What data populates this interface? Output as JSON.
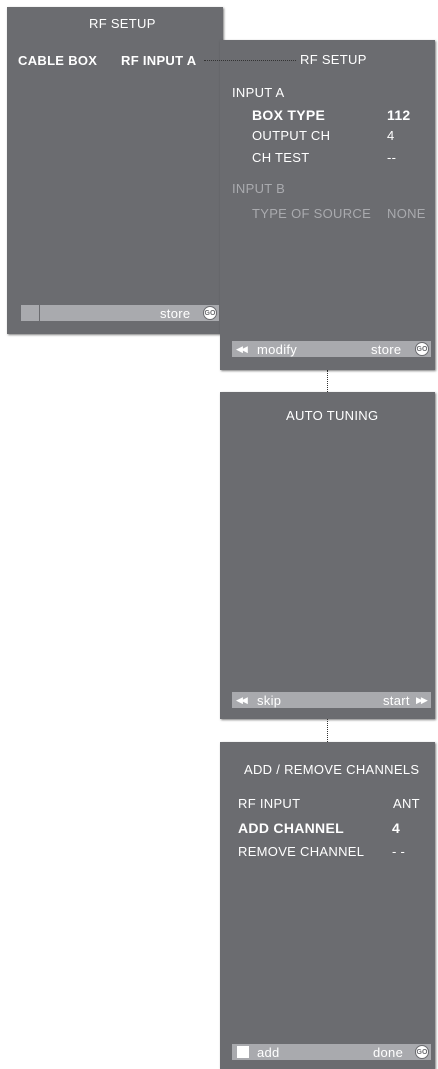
{
  "panel1": {
    "title": "RF  SETUP",
    "left_label": "CABLE  BOX",
    "right_label": "RF INPUT A",
    "bar": {
      "store": "store",
      "go": "GO"
    }
  },
  "panel2": {
    "title": "RF  SETUP",
    "input_a": "INPUT A",
    "rows": [
      {
        "label": "BOX  TYPE",
        "value": "112"
      },
      {
        "label": "OUTPUT  CH",
        "value": "4"
      },
      {
        "label": "CH  TEST",
        "value": "--"
      }
    ],
    "input_b": "INPUT B",
    "type_of_source": {
      "label": "TYPE  OF  SOURCE",
      "value": "NONE"
    },
    "bar": {
      "modify": "modify",
      "store": "store",
      "go": "GO"
    }
  },
  "panel3": {
    "title": "AUTO  TUNING",
    "bar": {
      "skip": "skip",
      "start": "start"
    }
  },
  "panel4": {
    "title": "ADD / REMOVE  CHANNELS",
    "rows": [
      {
        "label": "RF  INPUT",
        "value": "ANT"
      },
      {
        "label": "ADD  CHANNEL",
        "value": "4"
      },
      {
        "label": "REMOVE  CHANNEL",
        "value": "- -"
      }
    ],
    "bar": {
      "add": "add",
      "done": "done",
      "go": "GO"
    }
  }
}
